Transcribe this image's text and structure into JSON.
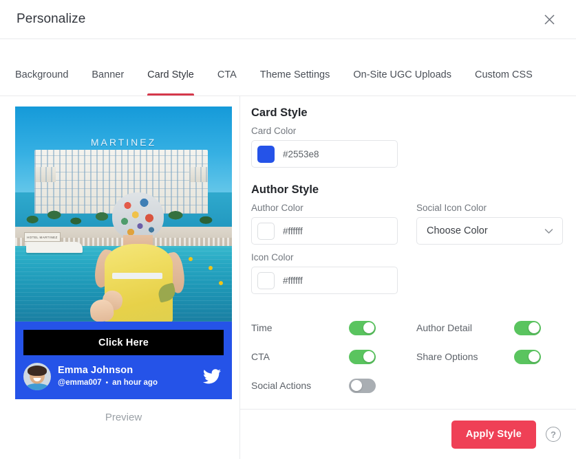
{
  "header": {
    "title": "Personalize",
    "close_icon": "close-icon"
  },
  "tabs": [
    {
      "label": "Background",
      "active": false
    },
    {
      "label": "Banner",
      "active": false
    },
    {
      "label": "Card Style",
      "active": true
    },
    {
      "label": "CTA",
      "active": false
    },
    {
      "label": "Theme Settings",
      "active": false
    },
    {
      "label": "On-Site UGC Uploads",
      "active": false
    },
    {
      "label": "Custom CSS",
      "active": false
    }
  ],
  "preview": {
    "label": "Preview",
    "card_background": "#2553e8",
    "image_sign_text": "MARTINEZ",
    "image_plaque_text": "HOTEL MARTINEZ",
    "cta_label": "Click Here",
    "cta_background": "#000000",
    "author_name": "Emma Johnson",
    "author_handle": "@emma007",
    "separator": "•",
    "timestamp": "an hour ago",
    "social_icon": "twitter-icon",
    "avatar": "avatar"
  },
  "form": {
    "card_style_title": "Card Style",
    "author_style_title": "Author Style",
    "card_color": {
      "label": "Card Color",
      "value": "#2553e8",
      "swatch": "#2553e8"
    },
    "author_color": {
      "label": "Author Color",
      "value": "#ffffff",
      "swatch": "#ffffff"
    },
    "icon_color": {
      "label": "Icon Color",
      "value": "#ffffff",
      "swatch": "#ffffff"
    },
    "social_icon_color": {
      "label": "Social Icon Color",
      "value": "Choose Color",
      "chevron": "chevron-down-icon"
    },
    "toggles": [
      {
        "label": "Time",
        "on": true
      },
      {
        "label": "Author Detail",
        "on": true
      },
      {
        "label": "CTA",
        "on": true
      },
      {
        "label": "Share Options",
        "on": true
      },
      {
        "label": "Social Actions",
        "on": false
      }
    ]
  },
  "footer": {
    "apply_label": "Apply Style",
    "help_label": "?",
    "apply_color": "#ef4056"
  }
}
